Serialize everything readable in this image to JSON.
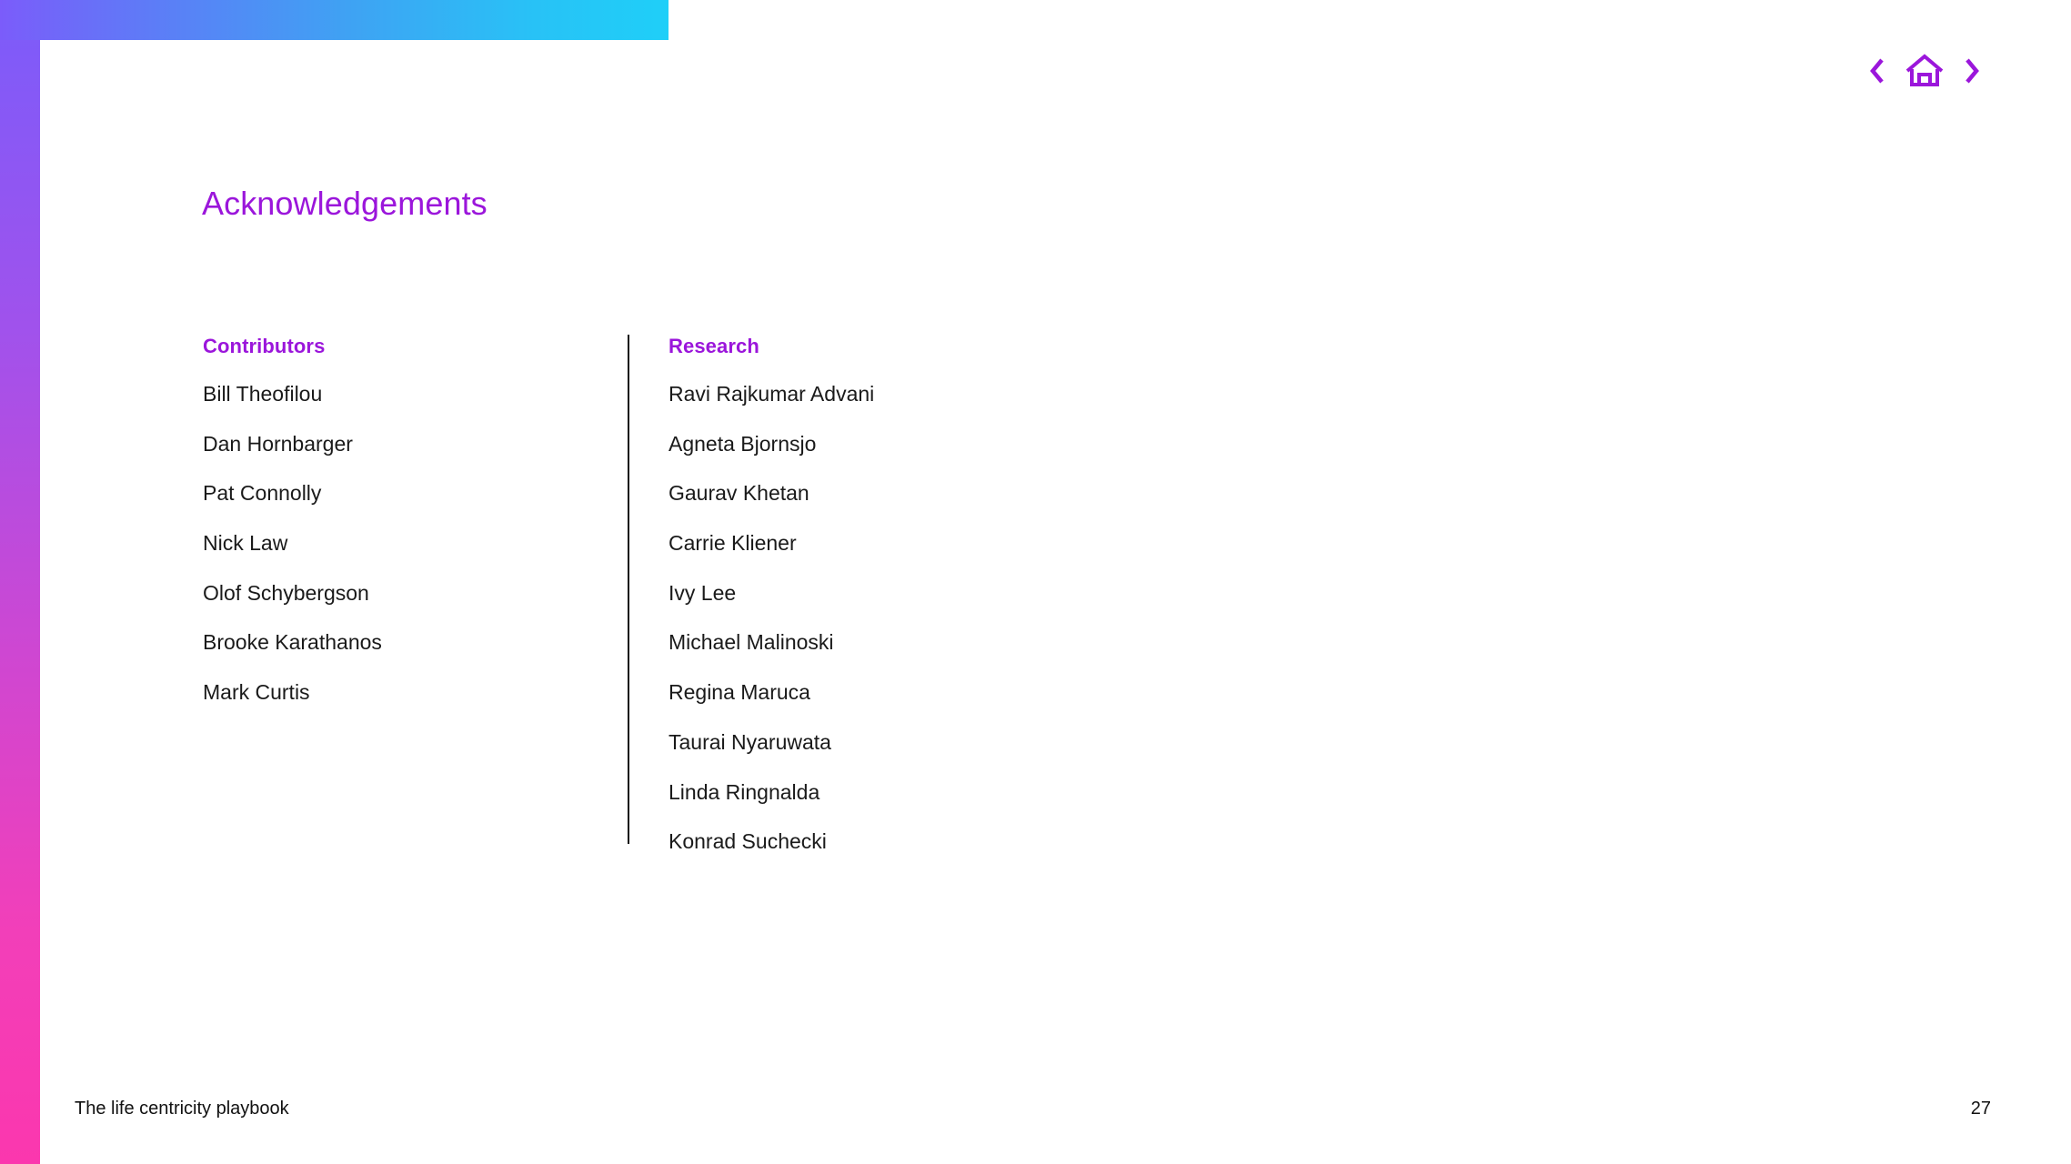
{
  "document": {
    "title": "Acknowledgements",
    "footer_title": "The life centricity playbook",
    "page_number": "27"
  },
  "navigation": {
    "prev_label": "‹",
    "home_label": "home-icon",
    "next_label": "›",
    "prev_name": "chevron-left-icon",
    "home_name": "home-icon",
    "next_name": "chevron-right-icon"
  },
  "columns": [
    {
      "heading": "Contributors",
      "names": [
        "Bill Theofilou",
        "Dan Hornbarger",
        "Pat Connolly",
        "Nick Law",
        "Olof Schybergson",
        "Brooke Karathanos",
        "Mark Curtis"
      ]
    },
    {
      "heading": "Research",
      "names": [
        "Ravi Rajkumar Advani",
        "Agneta Bjornsjo",
        "Gaurav Khetan",
        "Carrie Kliener",
        "Ivy Lee",
        "Michael Malinoski",
        "Regina Maruca",
        "Taurai Nyaruwata",
        "Linda Ringnalda",
        "Konrad Suchecki"
      ]
    }
  ],
  "colors": {
    "accent_purple": "#9B16DB",
    "gradient_top_start": "#7B5CFA",
    "gradient_top_end": "#1FCFF8",
    "gradient_left_start": "#7B5CFA",
    "gradient_left_end": "#FB37AE",
    "text": "#1A1A1A",
    "divider": "#111111"
  }
}
